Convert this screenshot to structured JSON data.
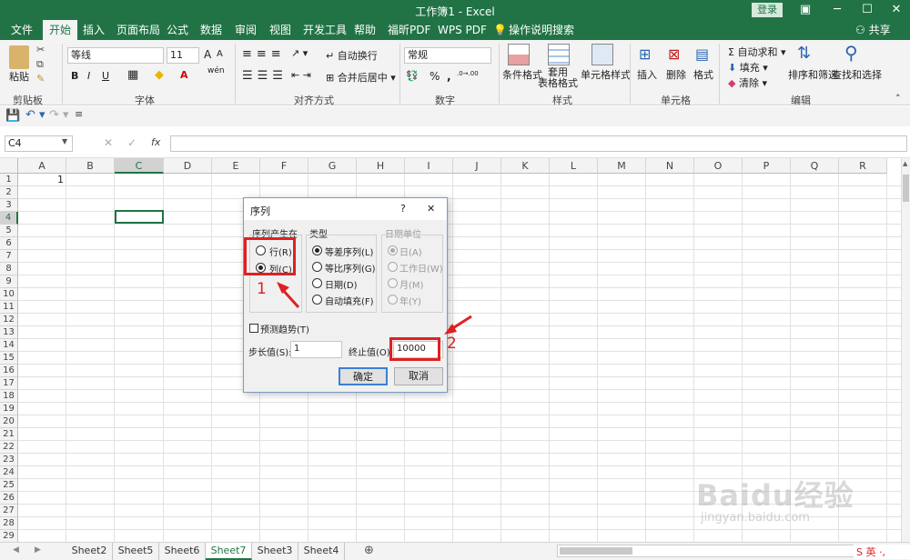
{
  "app": {
    "title": "工作簿1 - Excel",
    "login": "登录",
    "share": "共享"
  },
  "tabs": [
    "文件",
    "开始",
    "插入",
    "页面布局",
    "公式",
    "数据",
    "审阅",
    "视图",
    "开发工具",
    "帮助",
    "福昕PDF",
    "WPS PDF",
    "操作说明搜索"
  ],
  "ribbon": {
    "clipboard": {
      "paste": "粘贴",
      "group": "剪贴板"
    },
    "font": {
      "name": "等线",
      "size": "11",
      "group": "字体",
      "bold": "B",
      "italic": "I",
      "underline": "U",
      "grow": "A",
      "shrink": "A",
      "wen": "wén",
      "color_a": "A"
    },
    "align": {
      "wrap": "自动换行",
      "merge": "合并后居中",
      "group": "对齐方式"
    },
    "number": {
      "format": "常规",
      "percent": "%",
      "comma": ",",
      "group": "数字",
      "inc": ".0→.00",
      "dec": ".00→.0"
    },
    "styles": {
      "cond": "条件格式",
      "table": "套用\n表格格式",
      "cell": "单元格样式",
      "group": "样式"
    },
    "cells": {
      "insert": "插入",
      "delete": "删除",
      "format": "格式",
      "group": "单元格"
    },
    "edit": {
      "autosum": "自动求和",
      "fill": "填充",
      "clear": "清除",
      "sort": "排序和筛选",
      "find": "查找和选择",
      "group": "编辑"
    }
  },
  "formula_bar": {
    "name_box": "C4",
    "fx": "fx",
    "value": ""
  },
  "grid": {
    "columns": [
      "A",
      "B",
      "C",
      "D",
      "E",
      "F",
      "G",
      "H",
      "I",
      "J",
      "K",
      "L",
      "M",
      "N",
      "O",
      "P",
      "Q",
      "R"
    ],
    "rows": [
      "1",
      "2",
      "3",
      "4",
      "5",
      "6",
      "7",
      "8",
      "9",
      "10",
      "11",
      "12",
      "13",
      "14",
      "15",
      "16",
      "17",
      "18",
      "19",
      "20",
      "21",
      "22",
      "23",
      "24",
      "25",
      "26",
      "27",
      "28",
      "29"
    ],
    "a1": "1",
    "selected": "C4"
  },
  "sheets": [
    "Sheet2",
    "Sheet5",
    "Sheet6",
    "Sheet7",
    "Sheet3",
    "Sheet4"
  ],
  "active_sheet": "Sheet7",
  "dialog": {
    "title": "序列",
    "help": "?",
    "close": "✕",
    "series_in": {
      "label": "序列产生在",
      "options": [
        {
          "label": "行(R)",
          "selected": false
        },
        {
          "label": "列(C)",
          "selected": true
        }
      ]
    },
    "type": {
      "label": "类型",
      "options": [
        {
          "label": "等差序列(L)",
          "selected": true
        },
        {
          "label": "等比序列(G)",
          "selected": false
        },
        {
          "label": "日期(D)",
          "selected": false
        },
        {
          "label": "自动填充(F)",
          "selected": false
        }
      ]
    },
    "date_unit": {
      "label": "日期单位",
      "options": [
        {
          "label": "日(A)",
          "selected": true
        },
        {
          "label": "工作日(W)",
          "selected": false
        },
        {
          "label": "月(M)",
          "selected": false
        },
        {
          "label": "年(Y)",
          "selected": false
        }
      ]
    },
    "trend": {
      "label": "预测趋势(T)",
      "checked": false
    },
    "step": {
      "label": "步长值(S):",
      "value": "1"
    },
    "stop": {
      "label": "终止值(O):",
      "value": "10000"
    },
    "ok": "确定",
    "cancel": "取消"
  },
  "annotations": [
    "1",
    "2"
  ],
  "watermark": {
    "brand": "Baidu经验",
    "url": "jingyan.baidu.com"
  },
  "colors": {
    "excel_green": "#217346",
    "annotation_red": "#e02020"
  }
}
